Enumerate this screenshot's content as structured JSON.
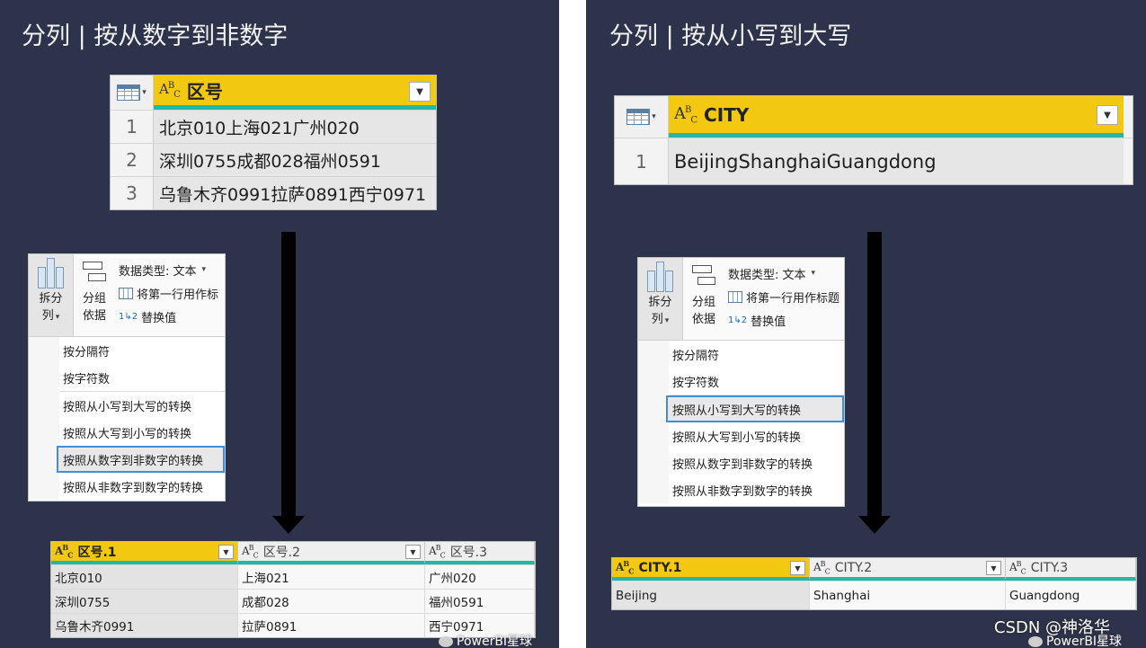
{
  "left": {
    "title": "分列 | 按从数字到非数字",
    "source_table": {
      "column": "区号",
      "rows": [
        {
          "n": "1",
          "value": "北京010上海021广州020"
        },
        {
          "n": "2",
          "value": "深圳0755成都028福州0591"
        },
        {
          "n": "3",
          "value": "乌鲁木齐0991拉萨0891西宁0971"
        }
      ]
    },
    "ribbon": {
      "split_label_1": "拆分",
      "split_label_2": "列",
      "group_label_1": "分组",
      "group_label_2": "依据",
      "data_type": "数据类型: 文本",
      "use_first_row": "将第一行用作标",
      "replace_values": "替换值"
    },
    "menu_items": [
      "按分隔符",
      "按字符数",
      "按照从小写到大写的转换",
      "按照从大写到小写的转换",
      "按照从数字到非数字的转换",
      "按照从非数字到数字的转换"
    ],
    "result": {
      "headers": [
        "区号.1",
        "区号.2",
        "区号.3"
      ],
      "rows": [
        [
          "北京010",
          "上海021",
          "广州020"
        ],
        [
          "深圳0755",
          "成都028",
          "福州0591"
        ],
        [
          "乌鲁木齐0991",
          "拉萨0891",
          "西宁0971"
        ]
      ]
    },
    "watermark": "PowerBI星球"
  },
  "right": {
    "title": "分列 | 按从小写到大写",
    "source_table": {
      "column": "CITY",
      "rows": [
        {
          "n": "1",
          "value": "BeijingShanghaiGuangdong"
        }
      ]
    },
    "ribbon": {
      "split_label_1": "拆分",
      "split_label_2": "列",
      "group_label_1": "分组",
      "group_label_2": "依据",
      "data_type": "数据类型: 文本",
      "use_first_row": "将第一行用作标题",
      "replace_values": "替换值"
    },
    "menu_items": [
      "按分隔符",
      "按字符数",
      "按照从小写到大写的转换",
      "按照从大写到小写的转换",
      "按照从数字到非数字的转换",
      "按照从非数字到数字的转换"
    ],
    "result": {
      "headers": [
        "CITY.1",
        "CITY.2",
        "CITY.3"
      ],
      "rows": [
        [
          "Beijing",
          "Shanghai",
          "Guangdong"
        ]
      ]
    },
    "watermark": "PowerBI星球",
    "csdn": "CSDN @神洛华"
  }
}
